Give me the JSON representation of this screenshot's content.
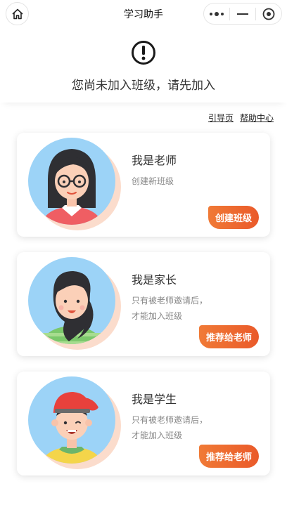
{
  "navbar": {
    "title": "学习助手",
    "home_icon": "home-icon",
    "more_icon": "more-dots-icon",
    "minimize_icon": "minimize-icon",
    "close_icon": "target-icon"
  },
  "notice": {
    "icon": "alert-circle-icon",
    "text": "您尚未加入班级，请先加入"
  },
  "links": {
    "guide": "引导页",
    "help": "帮助中心"
  },
  "cards": [
    {
      "title": "我是老师",
      "desc_line1": "创建新班级",
      "desc_line2": "",
      "button": "创建班级",
      "avatar": "teacher-avatar"
    },
    {
      "title": "我是家长",
      "desc_line1": "只有被老师邀请后，",
      "desc_line2": "才能加入班级",
      "button": "推荐给老师",
      "avatar": "parent-avatar"
    },
    {
      "title": "我是学生",
      "desc_line1": "只有被老师邀请后，",
      "desc_line2": "才能加入班级",
      "button": "推荐给老师",
      "avatar": "student-avatar"
    }
  ],
  "colors": {
    "accent": "#ed6a2f",
    "avatar_bg": "#8fd0f6",
    "avatar_shadow": "#fbd9c9"
  }
}
